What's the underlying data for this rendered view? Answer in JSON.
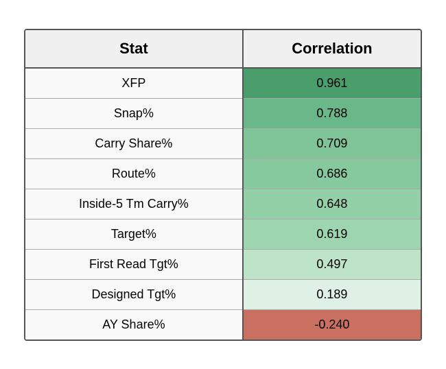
{
  "table": {
    "headers": {
      "stat": "Stat",
      "correlation": "Correlation"
    },
    "rows": [
      {
        "stat": "XFP",
        "correlation": "0.961",
        "bg": "#4a9e6b"
      },
      {
        "stat": "Snap%",
        "correlation": "0.788",
        "bg": "#6ab88a"
      },
      {
        "stat": "Carry Share%",
        "correlation": "0.709",
        "bg": "#7ec497"
      },
      {
        "stat": "Route%",
        "correlation": "0.686",
        "bg": "#87c99e"
      },
      {
        "stat": "Inside-5 Tm Carry%",
        "correlation": "0.648",
        "bg": "#93d0a8"
      },
      {
        "stat": "Target%",
        "correlation": "0.619",
        "bg": "#9dd5b0"
      },
      {
        "stat": "First Read Tgt%",
        "correlation": "0.497",
        "bg": "#bde3c8"
      },
      {
        "stat": "Designed Tgt%",
        "correlation": "0.189",
        "bg": "#dff0e5"
      },
      {
        "stat": "AY Share%",
        "correlation": "-0.240",
        "bg": "#c97060"
      }
    ]
  }
}
